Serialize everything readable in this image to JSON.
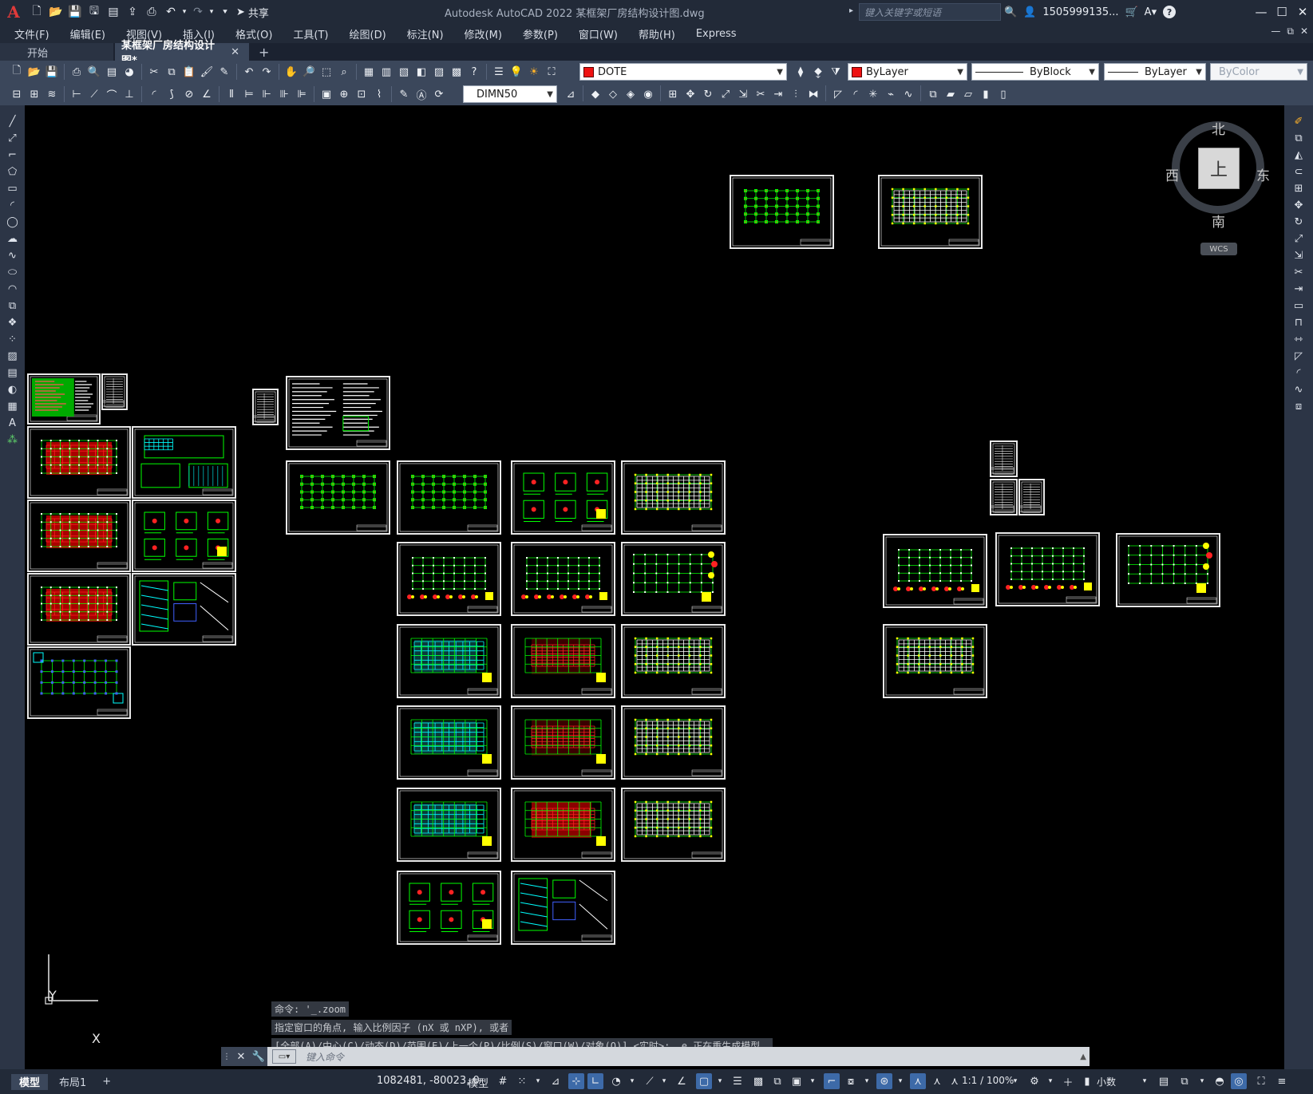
{
  "titlebar": {
    "app_logo": "A",
    "share_label": "共享",
    "title": "Autodesk AutoCAD 2022    某框架厂房结构设计图.dwg",
    "search_placeholder": "键入关键字或短语",
    "user": "1505999135...",
    "help": "?"
  },
  "menu": [
    "文件(F)",
    "编辑(E)",
    "视图(V)",
    "插入(I)",
    "格式(O)",
    "工具(T)",
    "绘图(D)",
    "标注(N)",
    "修改(M)",
    "参数(P)",
    "窗口(W)",
    "帮助(H)",
    "Express"
  ],
  "tabs": {
    "start": "开始",
    "drawing": "某框架厂房结构设计图*",
    "close": "✕",
    "add": "+"
  },
  "toolbar": {
    "layer": "DOTE",
    "color": "ByLayer",
    "linetype": "ByBlock",
    "lineweight": "ByLayer",
    "plotstyle": "ByColor",
    "dimstyle": "DIMN50",
    "layer_color": "#ee1111"
  },
  "viewcube": {
    "north": "北",
    "south": "南",
    "east": "东",
    "west": "西",
    "face": "上",
    "wcs": "WCS"
  },
  "ucs": {
    "x": "X",
    "y": "Y"
  },
  "command": {
    "history": [
      "命令: '_.zoom",
      "指定窗口的角点, 输入比例因子 (nX 或 nXP), 或者",
      "[全部(A)/中心(C)/动态(D)/范围(E)/上一个(P)/比例(S)/窗口(W)/对象(O)] <实时>: _e 正在重生成模型。"
    ],
    "placeholder": "键入命令"
  },
  "status": {
    "layouts": [
      "模型",
      "布局1"
    ],
    "add_layout": "+",
    "coords": "1082481, -80023, 0",
    "space": "模型",
    "scale": "1:1 / 100%",
    "units": "小数"
  }
}
